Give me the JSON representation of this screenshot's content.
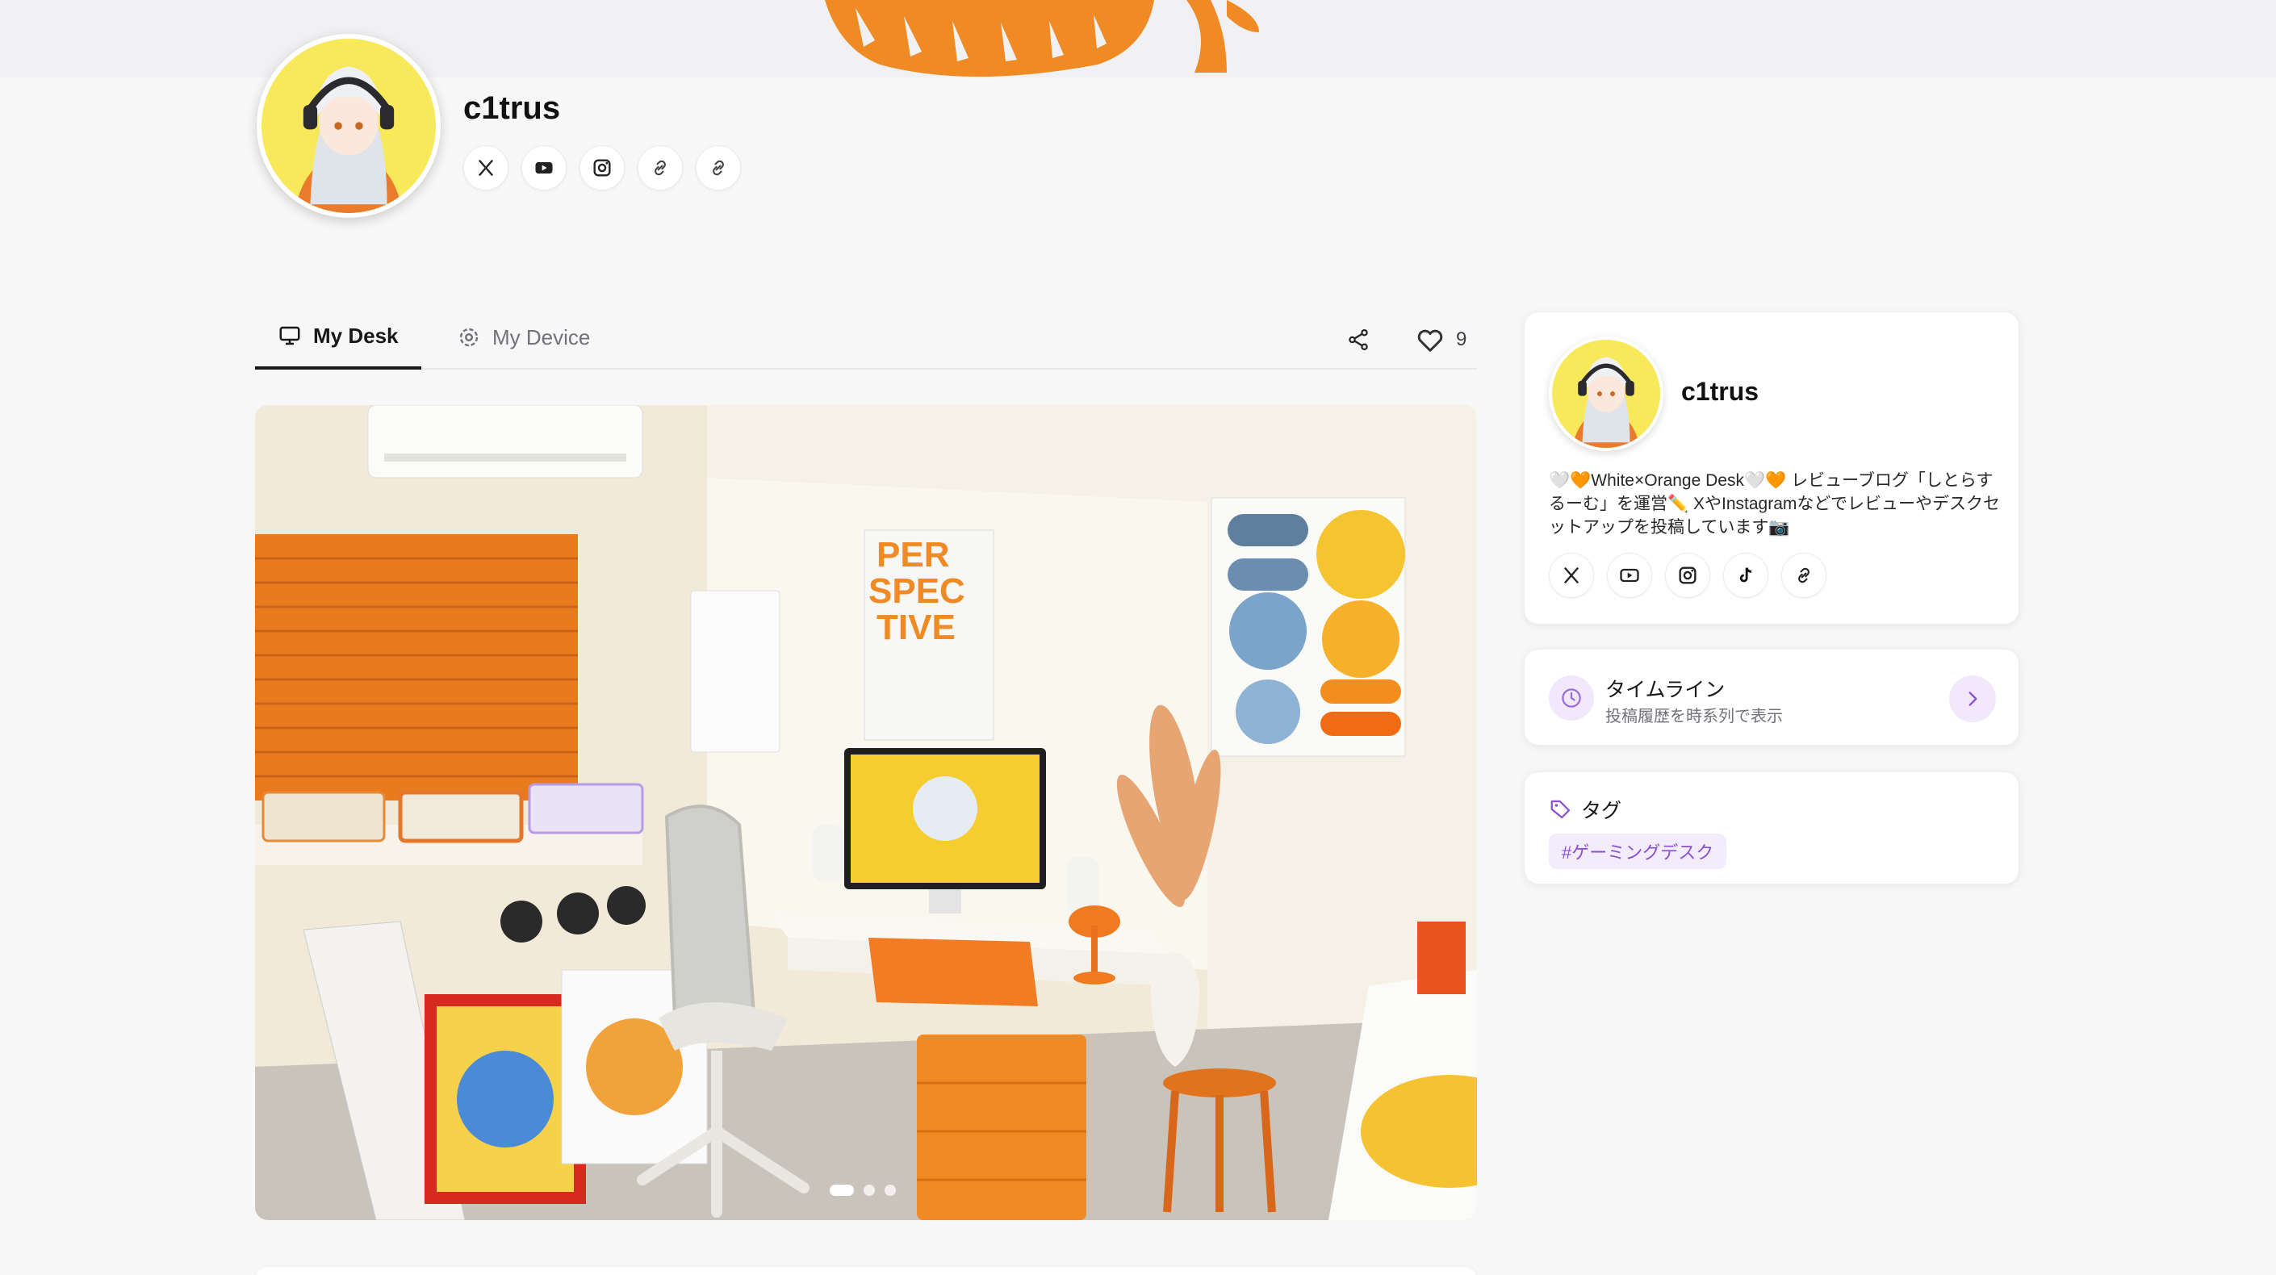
{
  "profile": {
    "username": "c1trus",
    "social": [
      {
        "icon": "x-icon"
      },
      {
        "icon": "youtube-icon"
      },
      {
        "icon": "instagram-icon"
      },
      {
        "icon": "link-icon"
      },
      {
        "icon": "link-icon"
      }
    ]
  },
  "tabs": [
    {
      "label": "My Desk",
      "icon": "monitor-icon",
      "active": true
    },
    {
      "label": "My Device",
      "icon": "gear-icon",
      "active": false
    }
  ],
  "actions": {
    "like_count": "9"
  },
  "carousel": {
    "slides": 3,
    "active_index": 0
  },
  "sidebar": {
    "profile_card": {
      "username": "c1trus",
      "bio": "🤍🧡White×Orange Desk🤍🧡 レビューブログ「しとらするーむ」を運営✏️ XやInstagramなどでレビューやデスクセットアップを投稿しています📷",
      "social": [
        {
          "icon": "x-icon"
        },
        {
          "icon": "youtube-icon"
        },
        {
          "icon": "instagram-icon"
        },
        {
          "icon": "tiktok-icon"
        },
        {
          "icon": "link-icon"
        }
      ]
    },
    "timeline_card": {
      "title": "タイムライン",
      "subtitle": "投稿履歴を時系列で表示"
    },
    "tags_card": {
      "title": "タグ",
      "tags": [
        "#ゲーミングデスク"
      ]
    }
  },
  "colors": {
    "brand_orange": "#f08a24",
    "accent_purple": "#8b4fd1",
    "accent_purple_bg": "#f1e9fb"
  }
}
